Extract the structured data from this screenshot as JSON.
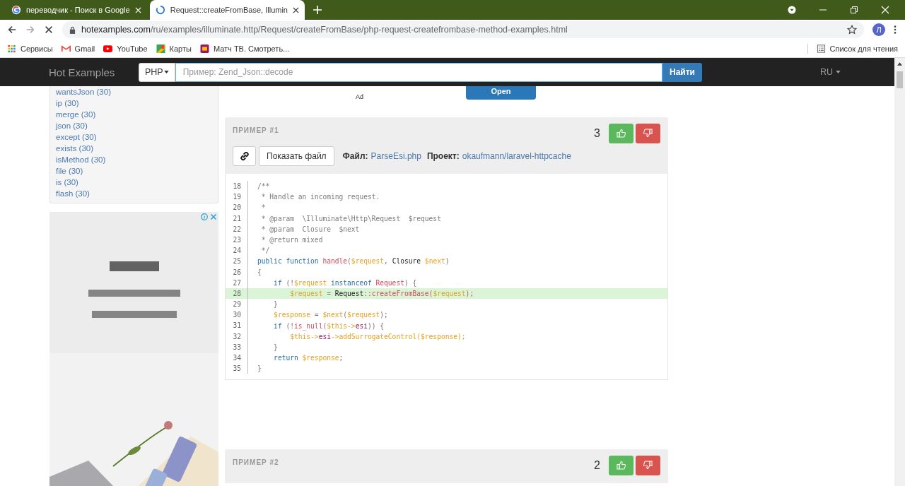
{
  "browser": {
    "tabs": [
      {
        "title": "переводчик - Поиск в Google",
        "selected": false,
        "loading": false
      },
      {
        "title": "Request::createFromBase, Illumin",
        "selected": true,
        "loading": true
      }
    ],
    "url": {
      "host": "hotexamples.com",
      "path": "/ru/examples/illuminate.http/Request/createFromBase/php-request-createfrombase-method-examples.html"
    },
    "profile_initial": "Л",
    "bookmarks": [
      {
        "label": "Сервисы",
        "kind": "apps"
      },
      {
        "label": "Gmail",
        "kind": "mail"
      },
      {
        "label": "YouTube",
        "kind": "video"
      },
      {
        "label": "Карты",
        "kind": "map"
      },
      {
        "label": "Матч ТВ. Смотреть...",
        "kind": "tv"
      }
    ],
    "reading_list": "Список для чтения"
  },
  "navbar": {
    "brand": "Hot Examples",
    "language": "PHP",
    "placeholder": "Пример: Zend_Json::decode",
    "search_button": "Найти",
    "locale": "RU"
  },
  "sidebar": {
    "methods": [
      "wantsJson (30)",
      "ip (30)",
      "merge (30)",
      "json (30)",
      "except (30)",
      "exists (30)",
      "isMethod (30)",
      "file (30)",
      "is (30)",
      "flash (30)"
    ]
  },
  "top_ad": {
    "label": "Ad",
    "button": "Open"
  },
  "examples": [
    {
      "title": "ПРИМЕР #1",
      "votes": "3",
      "show_file": "Показать файл",
      "file_label": "Файл:",
      "file": "ParseEsi.php",
      "project_label": "Проект:",
      "project": "okaufmann/laravel-httpcache",
      "code": [
        {
          "number": "18",
          "highlighted": false,
          "tokens": [
            {
              "kind": "comment",
              "text": "/**"
            }
          ]
        },
        {
          "number": "19",
          "highlighted": false,
          "tokens": [
            {
              "kind": "comment",
              "text": " * Handle an incoming request."
            }
          ]
        },
        {
          "number": "20",
          "highlighted": false,
          "tokens": [
            {
              "kind": "comment",
              "text": " *"
            }
          ]
        },
        {
          "number": "21",
          "highlighted": false,
          "tokens": [
            {
              "kind": "comment",
              "text": " * @param  \\Illuminate\\Http\\Request  $request"
            }
          ]
        },
        {
          "number": "22",
          "highlighted": false,
          "tokens": [
            {
              "kind": "comment",
              "text": " * @param  Closure  $next"
            }
          ]
        },
        {
          "number": "23",
          "highlighted": false,
          "tokens": [
            {
              "kind": "comment",
              "text": " * @return mixed"
            }
          ]
        },
        {
          "number": "24",
          "highlighted": false,
          "tokens": [
            {
              "kind": "comment",
              "text": " */"
            }
          ]
        },
        {
          "number": "25",
          "highlighted": false,
          "tokens": [
            {
              "kind": "keyword",
              "text": "public function "
            },
            {
              "kind": "name",
              "text": "handle"
            },
            {
              "kind": "punct",
              "text": "("
            },
            {
              "kind": "variable",
              "text": "$request"
            },
            {
              "kind": "punct",
              "text": ", "
            },
            {
              "kind": "type",
              "text": "Closure "
            },
            {
              "kind": "variable",
              "text": "$next"
            },
            {
              "kind": "punct",
              "text": ")"
            }
          ]
        },
        {
          "number": "26",
          "highlighted": false,
          "tokens": [
            {
              "kind": "punct",
              "text": "{"
            }
          ]
        },
        {
          "number": "27",
          "highlighted": false,
          "tokens": [
            {
              "kind": "keyword",
              "text": "    if"
            },
            {
              "kind": "punct",
              "text": " (!"
            },
            {
              "kind": "variable",
              "text": "$request"
            },
            {
              "kind": "keyword",
              "text": " instanceof "
            },
            {
              "kind": "name",
              "text": "Request"
            },
            {
              "kind": "punct",
              "text": ") {"
            }
          ]
        },
        {
          "number": "28",
          "highlighted": true,
          "tokens": [
            {
              "kind": "variable",
              "text": "        $request"
            },
            {
              "kind": "punct",
              "text": " = "
            },
            {
              "kind": "type",
              "text": "Request"
            },
            {
              "kind": "name",
              "text": "::createFromBase("
            },
            {
              "kind": "variable",
              "text": "$request"
            },
            {
              "kind": "name",
              "text": ");"
            }
          ]
        },
        {
          "number": "29",
          "highlighted": false,
          "tokens": [
            {
              "kind": "punct",
              "text": "    }"
            }
          ]
        },
        {
          "number": "30",
          "highlighted": false,
          "tokens": [
            {
              "kind": "variable",
              "text": "    $response"
            },
            {
              "kind": "punct",
              "text": " = "
            },
            {
              "kind": "variable",
              "text": "$next"
            },
            {
              "kind": "punct",
              "text": "("
            },
            {
              "kind": "variable",
              "text": "$request"
            },
            {
              "kind": "punct",
              "text": ");"
            }
          ]
        },
        {
          "number": "31",
          "highlighted": false,
          "tokens": [
            {
              "kind": "keyword",
              "text": "    if"
            },
            {
              "kind": "punct",
              "text": " (!"
            },
            {
              "kind": "name",
              "text": "is_null"
            },
            {
              "kind": "punct",
              "text": "("
            },
            {
              "kind": "variable",
              "text": "$this->"
            },
            {
              "kind": "property",
              "text": "esi"
            },
            {
              "kind": "punct",
              "text": ")) {"
            }
          ]
        },
        {
          "number": "32",
          "highlighted": false,
          "tokens": [
            {
              "kind": "variable",
              "text": "        $this->"
            },
            {
              "kind": "property",
              "text": "esi"
            },
            {
              "kind": "variable",
              "text": "->addSurrogateControl("
            },
            {
              "kind": "variable",
              "text": "$response"
            },
            {
              "kind": "variable",
              "text": ");"
            }
          ]
        },
        {
          "number": "33",
          "highlighted": false,
          "tokens": [
            {
              "kind": "punct",
              "text": "    }"
            }
          ]
        },
        {
          "number": "34",
          "highlighted": false,
          "tokens": [
            {
              "kind": "keyword",
              "text": "    return "
            },
            {
              "kind": "variable",
              "text": "$response"
            },
            {
              "kind": "punct",
              "text": ";"
            }
          ]
        },
        {
          "number": "35",
          "highlighted": false,
          "tokens": [
            {
              "kind": "punct",
              "text": "}"
            }
          ]
        }
      ]
    },
    {
      "title": "ПРИМЕР #2",
      "votes": "2"
    }
  ]
}
